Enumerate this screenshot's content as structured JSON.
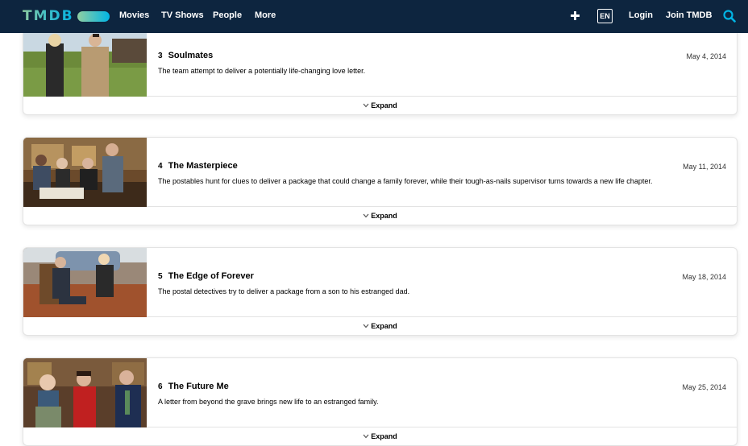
{
  "header": {
    "logo_text": "TMDB",
    "nav": [
      "Movies",
      "TV Shows",
      "People",
      "More"
    ],
    "language": "EN",
    "login": "Login",
    "join": "Join TMDB",
    "colors": {
      "bar": "#0d253f",
      "accent": "#01b4e4",
      "accent_green": "#90cea1"
    }
  },
  "episodes": [
    {
      "number": "3",
      "title": "Soulmates",
      "date": "May 4, 2014",
      "overview": "The team attempt to deliver a potentially life-changing love letter.",
      "expand": "Expand"
    },
    {
      "number": "4",
      "title": "The Masterpiece",
      "date": "May 11, 2014",
      "overview": "The postables hunt for clues to deliver a package that could change a family forever, while their tough-as-nails supervisor turns towards a new life chapter.",
      "expand": "Expand"
    },
    {
      "number": "5",
      "title": "The Edge of Forever",
      "date": "May 18, 2014",
      "overview": "The postal detectives try to deliver a package from a son to his estranged dad.",
      "expand": "Expand"
    },
    {
      "number": "6",
      "title": "The Future Me",
      "date": "May 25, 2014",
      "overview": "A letter from beyond the grave brings new life to an estranged family.",
      "expand": "Expand"
    }
  ]
}
